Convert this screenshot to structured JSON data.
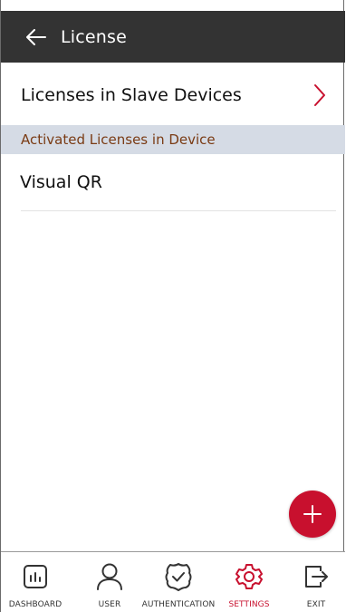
{
  "header": {
    "title": "License",
    "back_icon": "arrow-left-icon"
  },
  "slave_row": {
    "label": "Licenses in Slave Devices",
    "icon": "chevron-right-icon"
  },
  "section": {
    "title": "Activated Licenses in Device"
  },
  "licenses": [
    {
      "name": "Visual QR"
    }
  ],
  "fab": {
    "icon": "plus-icon"
  },
  "bottom_nav": {
    "items": [
      {
        "label": "DASHBOARD",
        "icon": "dashboard-icon",
        "active": false
      },
      {
        "label": "USER",
        "icon": "user-icon",
        "active": false
      },
      {
        "label": "AUTHENTICATION",
        "icon": "shield-check-icon",
        "active": false
      },
      {
        "label": "SETTINGS",
        "icon": "gear-icon",
        "active": true
      },
      {
        "label": "EXIT",
        "icon": "exit-icon",
        "active": false
      }
    ]
  },
  "colors": {
    "app_bar": "#333333",
    "accent": "#c8102e",
    "section_bg": "#d5dbe5",
    "section_text": "#7a3b14"
  }
}
